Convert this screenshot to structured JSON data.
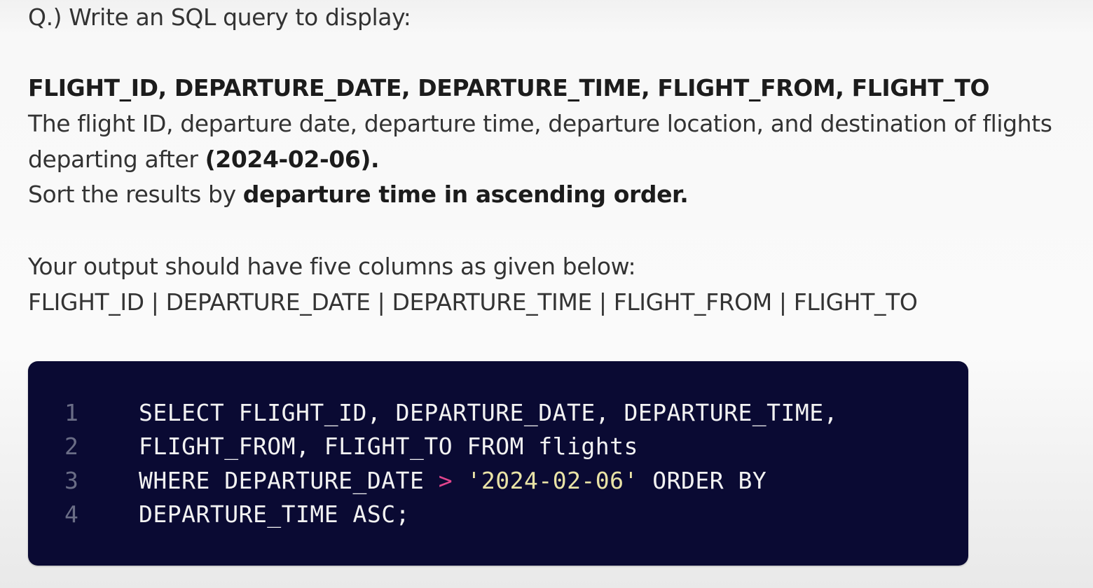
{
  "question": {
    "prompt": "Q.) Write an SQL query to display:",
    "columns_heading": "FLIGHT_ID, DEPARTURE_DATE, DEPARTURE_TIME, FLIGHT_FROM, FLIGHT_TO",
    "description_line_1": "The flight ID, departure date, departure time, departure location, and destination of flights",
    "description_line_2_prefix": "departing after ",
    "description_line_2_date": "(2024-02-06).",
    "sort_prefix": "Sort the results by ",
    "sort_emphasis": "departure time in ascending order.",
    "output_intro": "Your output should have five columns as given below:",
    "output_columns": "FLIGHT_ID | DEPARTURE_DATE | DEPARTURE_TIME | FLIGHT_FROM | FLIGHT_TO"
  },
  "code_block": {
    "background_color": "#0a0a33",
    "lines": [
      {
        "number": "1",
        "text": "SELECT FLIGHT_ID, DEPARTURE_DATE, DEPARTURE_TIME,"
      },
      {
        "number": "2",
        "text": "FLIGHT_FROM, FLIGHT_TO FROM flights"
      },
      {
        "number": "3",
        "before_operator": "WHERE DEPARTURE_DATE ",
        "operator": ">",
        "quote_open": "'",
        "string_value": "2024-02-06",
        "quote_close": "'",
        "after_string": " ORDER BY"
      },
      {
        "number": "4",
        "text": "DEPARTURE_TIME ASC;"
      }
    ],
    "colors": {
      "keyword_text": "#f2f2f2",
      "operator": "#e2458d",
      "string": "#e9e3a6",
      "line_number": "#6a6d86"
    }
  }
}
